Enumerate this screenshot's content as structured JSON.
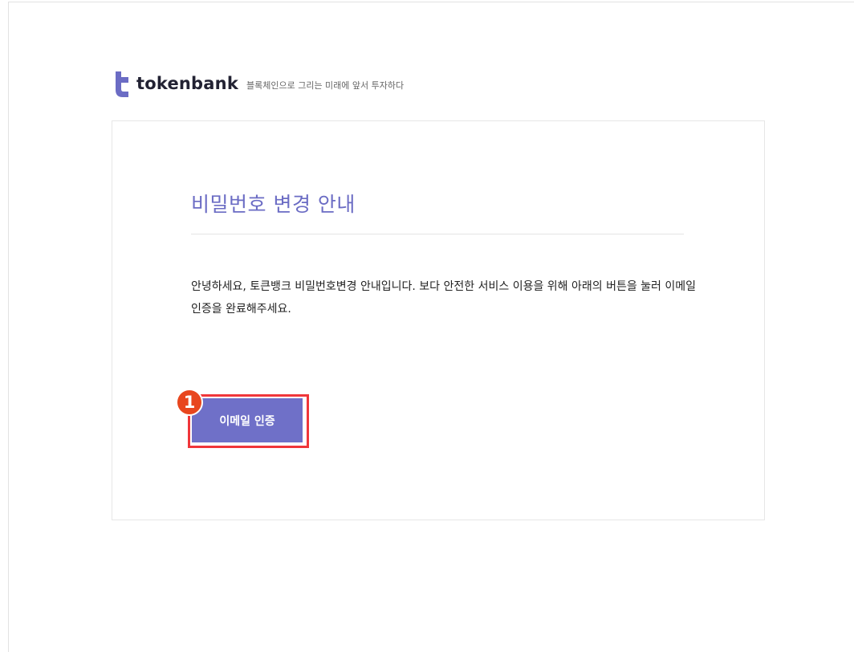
{
  "brand": {
    "name": "tokenbank",
    "tagline": "블록체인으로 그리는 미래에 앞서 투자하다",
    "color": "#6b6cc4"
  },
  "email": {
    "title": "비밀번호 변경 안내",
    "body": "안녕하세요, 토큰뱅크 비밀번호변경 안내입니다. 보다 안전한 서비스 이용을 위해 아래의 버튼을 눌러 이메일 인증을 완료해주세요.",
    "button_label": "이메일 인증",
    "button_color": "#6f70c8"
  },
  "annotation": {
    "step_number": "1",
    "badge_color": "#e8461e",
    "highlight_color": "#f0363a"
  }
}
